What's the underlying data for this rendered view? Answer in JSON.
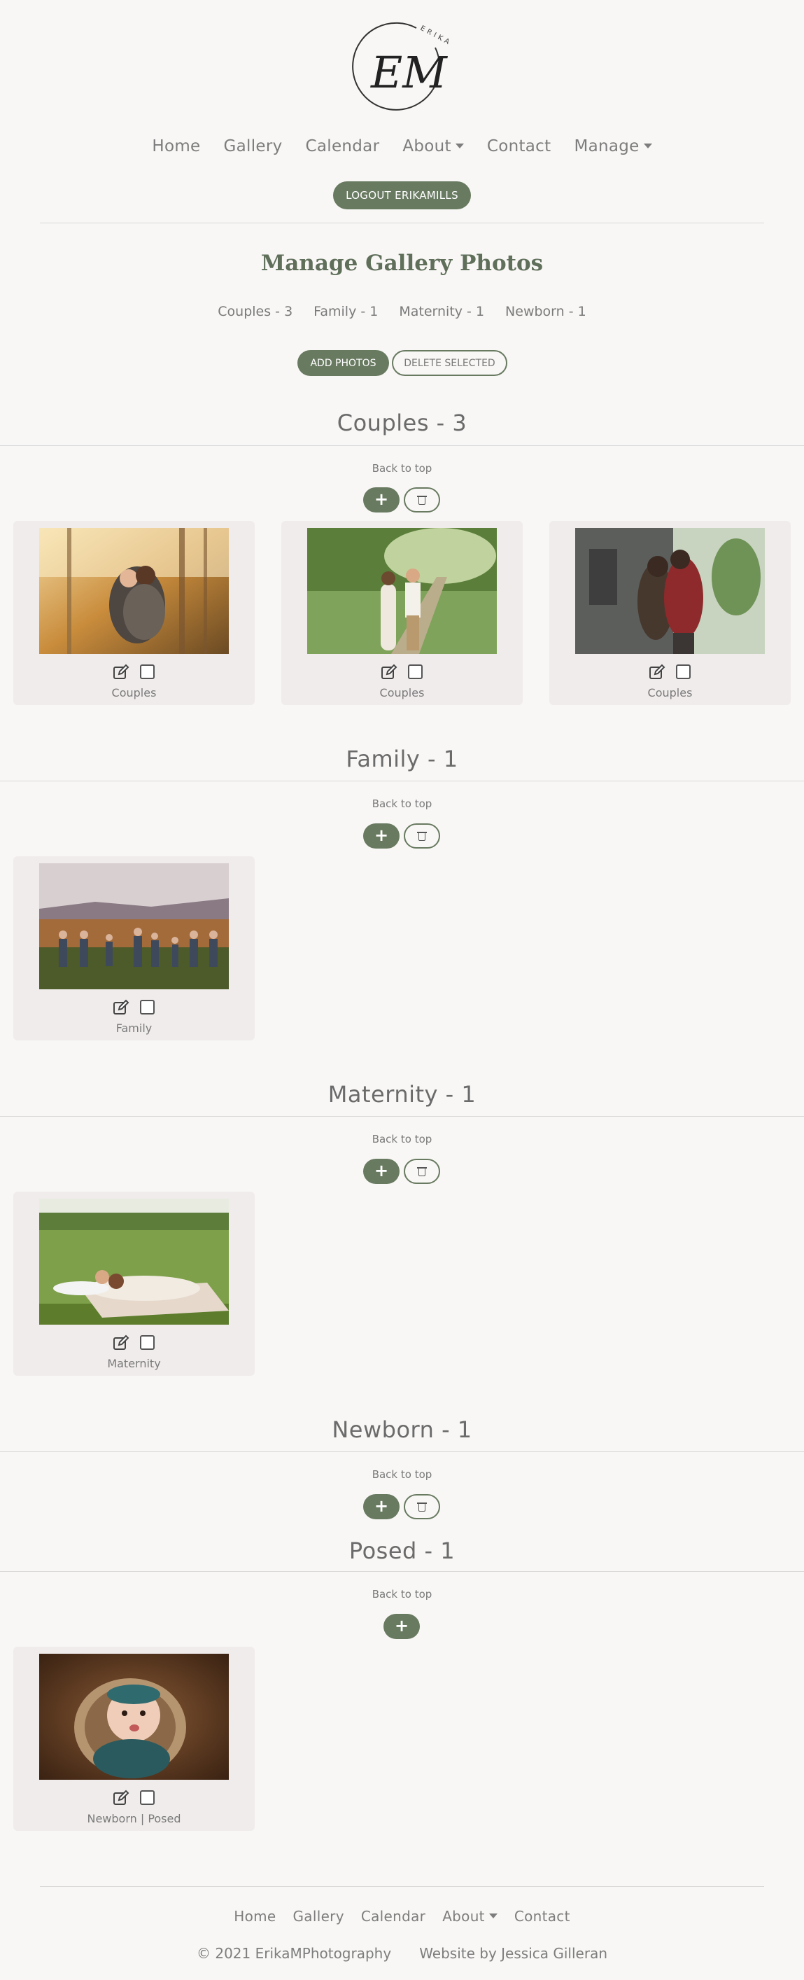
{
  "logo": {
    "monogram": "EM",
    "ring_text": "ERIKA MILLS"
  },
  "nav": {
    "home": "Home",
    "gallery": "Gallery",
    "calendar": "Calendar",
    "about": "About",
    "contact": "Contact",
    "manage": "Manage"
  },
  "logout_label": "LOGOUT ERIKAMILLS",
  "page_title": "Manage Gallery Photos",
  "category_links": [
    "Couples - 3",
    "Family - 1",
    "Maternity - 1",
    "Newborn - 1"
  ],
  "actions": {
    "add_photos": "ADD PHOTOS",
    "delete_selected": "DELETE SELECTED"
  },
  "back_to_top": "Back to top",
  "sections": [
    {
      "title": "Couples - 3",
      "photos": [
        {
          "label": "Couples"
        },
        {
          "label": "Couples"
        },
        {
          "label": "Couples"
        }
      ]
    },
    {
      "title": "Family - 1",
      "photos": [
        {
          "label": "Family"
        }
      ]
    },
    {
      "title": "Maternity - 1",
      "photos": [
        {
          "label": "Maternity"
        }
      ]
    },
    {
      "title": "Newborn - 1",
      "photos": []
    },
    {
      "title": "Posed - 1",
      "photos": [
        {
          "label": "Newborn | Posed"
        }
      ]
    }
  ],
  "footer": {
    "nav": {
      "home": "Home",
      "gallery": "Gallery",
      "calendar": "Calendar",
      "about": "About",
      "contact": "Contact"
    },
    "copyright": "© 2021 ErikaMPhotography",
    "credit": "Website by Jessica Gilleran"
  },
  "colors": {
    "accent": "#687a60",
    "card_bg": "#f1ecec",
    "page_bg": "#f8f7f5"
  }
}
